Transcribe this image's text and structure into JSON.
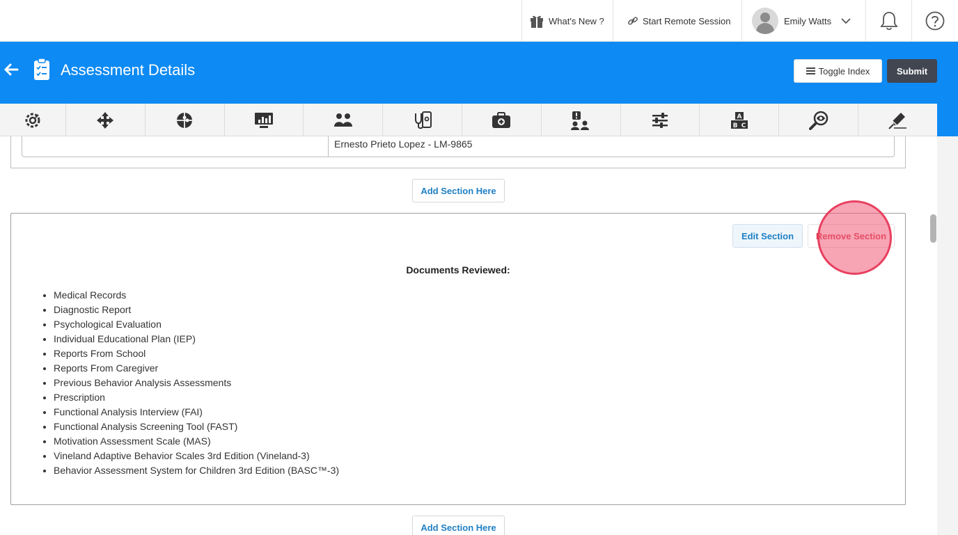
{
  "topbar": {
    "whats_new": "What's New ?",
    "remote_session": "Start Remote Session",
    "user_name": "Emily Watts"
  },
  "header": {
    "title": "Assessment Details",
    "toggle_index": "Toggle Index",
    "submit": "Submit",
    "background_color": "#0d8af3"
  },
  "toolbar": {
    "icons": [
      "settings-gear-icon",
      "move-arrows-icon",
      "puzzle-icon",
      "monitor-chart-icon",
      "group-people-icon",
      "medical-stethoscope-icon",
      "first-aid-kit-icon",
      "user-alert-icon",
      "sliders-icon",
      "abc-blocks-icon",
      "magnify-eye-icon",
      "pen-signature-icon"
    ]
  },
  "signature_row": {
    "value": "Ernesto Prieto Lopez - LM-9865"
  },
  "add_section_label": "Add Section Here",
  "section": {
    "edit_label": "Edit Section",
    "remove_label": "Remove Section",
    "heading": "Documents Reviewed:",
    "documents": [
      "Medical Records",
      "Diagnostic Report",
      "Psychological Evaluation",
      "Individual Educational Plan (IEP)",
      "Reports From School",
      "Reports From Caregiver",
      "Previous Behavior Analysis Assessments",
      "Prescription",
      "Functional Analysis Interview (FAI)",
      "Functional Analysis Screening Tool (FAST)",
      "Motivation Assessment Scale (MAS)",
      "Vineland Adaptive Behavior Scales 3rd Edition (Vineland-3)",
      "Behavior Assessment System for Children 3rd Edition (BASC™-3)"
    ]
  }
}
